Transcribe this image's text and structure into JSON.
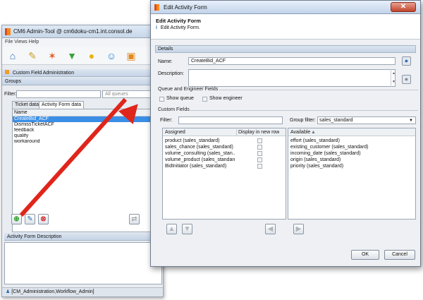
{
  "bg": {
    "title": "CM6 Admin-Tool @ cm6doku-cm1.int.consol.de",
    "menu": "File  Views  Help",
    "section": "Custom Field Administration",
    "groups": "Groups",
    "filter_label": "Filter:",
    "queue_placeholder": "All queues",
    "tabs": [
      "Ticket data",
      "Activity Form data"
    ],
    "list_header": "Name",
    "forms": [
      "CreateBid_ACF",
      "DismissTicketACF",
      "feedback",
      "qualify",
      "workaround"
    ],
    "desc_header": "Activity Form Description",
    "status": "[CM_Administration,Workflow_Admin]"
  },
  "dialog": {
    "title": "Edit Activity Form",
    "heading": "Edit Activity Form",
    "subheading": "Edit Activity Form.",
    "details": "Details",
    "name_label": "Name:",
    "name_value": "CreateBid_ACF",
    "desc_label": "Description:",
    "qe_fields": "Queue and Engineer Fields",
    "show_queue": "Show queue",
    "show_engineer": "Show engineer",
    "custom_fields": "Custom Fields",
    "filter_label": "Filter:",
    "group_filter_label": "Group filter:",
    "group_filter_value": "sales_standard",
    "assigned_header": "Assigned",
    "display_header": "Display in new row",
    "available_header": "Available",
    "assigned": [
      "product (sales_standard)",
      "sales_chance (sales_standard)",
      "volume_consulting (sales_stan...",
      "volume_product (sales_standard)",
      "BidInitiator (sales_standard)"
    ],
    "available": [
      "effort (sales_standard)",
      "existing_customer (sales_standard)",
      "incoming_date (sales_standard)",
      "origin (sales_standard)",
      "priority (sales_standard)"
    ],
    "ok": "OK",
    "cancel": "Cancel"
  },
  "colors": {
    "accent": "#e0251b",
    "selection": "#3a8ee6"
  }
}
